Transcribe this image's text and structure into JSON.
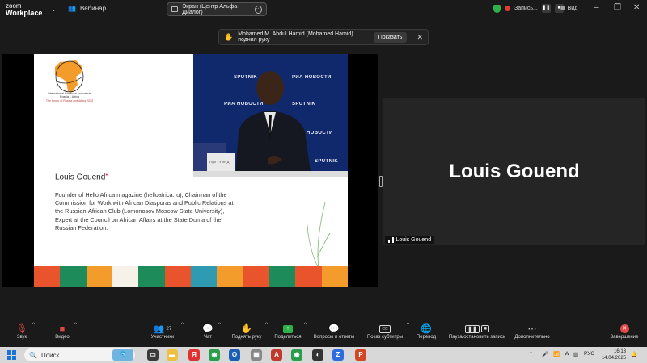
{
  "app": {
    "brand_line1": "zoom",
    "brand_line2": "Workplace",
    "meeting_label": "Вебинар"
  },
  "share": {
    "label": "Экран (Центр Альфа-Диалог)"
  },
  "recording": {
    "label": "Запись..."
  },
  "view": {
    "label": "Вид"
  },
  "notice": {
    "text": "Mohamed M. Abdul Hamid (Mohamed Hamid) поднял руку",
    "button": "Показать"
  },
  "slide": {
    "forum_title": "International Forum of Journalists Russia – Africa",
    "forum_sub": "The forum of Russia and Africa 2025",
    "name": "Louis Gouend",
    "bio": "Founder of Hello Africa magazine (helloafrica.ru), Chairman of the Commission for Work with African Diasporas and Public Relations at the Russian-African Club (Lomonosov Moscow State University), Expert at the Council on African Affairs at the State Duma of the Russian Federation.",
    "wall_logos": [
      "SPUTNIK",
      "РИА НОВОСТИ",
      "РИА НОВОСТИ",
      "SPUTNIK",
      "РИА НОВОСТИ",
      "SPUTNIK"
    ],
    "nameplate": "Луи ГУЭНД"
  },
  "participant": {
    "name": "Louis Gouend",
    "label": "Louis Gouend"
  },
  "toolbar": {
    "mic": "Звук",
    "video": "Видео",
    "participants": "Участники",
    "participants_count": "27",
    "chat": "Чат",
    "raise": "Поднять руку",
    "share": "Поделиться",
    "qa": "Вопросы и ответы",
    "subtitles": "Показ субтитры",
    "interp": "Перевод",
    "pause_rec": "Пауза/остановить запись",
    "more": "Дополнительно",
    "end": "Завершение"
  },
  "taskbar": {
    "search": "Поиск",
    "lang": "РУС",
    "time": "16:13",
    "date": "14.04.2025"
  }
}
